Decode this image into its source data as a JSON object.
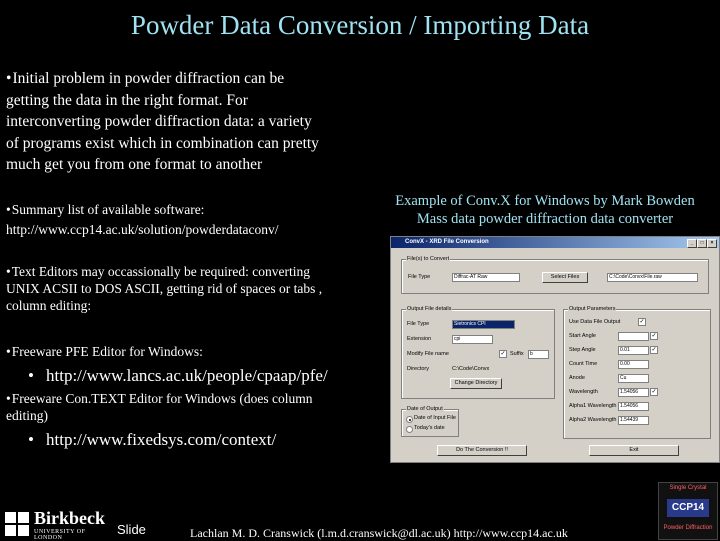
{
  "title": "Powder Data Conversion / Importing Data",
  "intro": [
    "Initial problem in powder diffraction can be",
    "getting the data in the right format.  For",
    "interconverting powder diffraction data: a variety",
    "of programs exist which in combination can pretty",
    "much get you from one format to another"
  ],
  "summary": {
    "text": "Summary list of available software:",
    "url": "http://www.ccp14.ac.uk/solution/powderdataconv/"
  },
  "caption": [
    "Example of Conv.X for Windows by Mark Bowden",
    "Mass data powder diffraction data converter"
  ],
  "text_editors": [
    "Text Editors may occassionally be required: converting",
    "UNIX ACSII to DOS ASCII, getting rid of spaces or tabs ,",
    "column editing:"
  ],
  "pfe": {
    "text": "Freeware PFE Editor for Windows:",
    "url": "http://www.lancs.ac.uk/people/cpaap/pfe/"
  },
  "context": {
    "text": [
      "Freeware Con.TEXT Editor for Windows (does column",
      "editing)"
    ],
    "url": "http://www.fixedsys.com/context/"
  },
  "dialog": {
    "title": "ConvX - XRD File Conversion",
    "files_group": "File(s) to Convert",
    "file_label": "File Type",
    "file_type": "Diffrac-AT Raw",
    "select_files": "Select Files",
    "file_name": "C:\\Code\\Convx\\File.raw",
    "output_group": "Output File details",
    "output_labels": [
      "File Type",
      "Extension",
      "Modify File name",
      "Directory"
    ],
    "output_type": "Sietronics CPI",
    "extension": "cpi",
    "suffix_label": "Suffix",
    "suffix": "b",
    "directory": "C:\\Code\\Convx",
    "change_dir": "Change Directory",
    "params_group": "Output Parameters",
    "param_labels": [
      "Use Data File Output",
      "Start Angle",
      "Step Angle",
      "Count Time",
      "Anode",
      "Wavelength",
      "Alpha1 Wavelength",
      "Alpha2 Wavelength"
    ],
    "param_values": [
      "",
      "",
      "0.01",
      "0.00",
      "Cu",
      "1.54056",
      "1.54056",
      "1.54439"
    ],
    "date_group": "Date of Output",
    "date_options": [
      "Date of Input File",
      "Today's date"
    ],
    "do_conversion": "Do The Conversion !!",
    "exit": "Exit"
  },
  "footer": {
    "logo": "Birkbeck",
    "logo_sub": "UNIVERSITY OF LONDON",
    "slide": "Slide",
    "credit": "Lachlan M. D. Cranswick (l.m.d.cranswick@dl.ac.uk) http://www.ccp14.ac.uk",
    "badge": [
      "Single Crystal",
      "CCP14",
      "Powder Diffraction"
    ]
  }
}
